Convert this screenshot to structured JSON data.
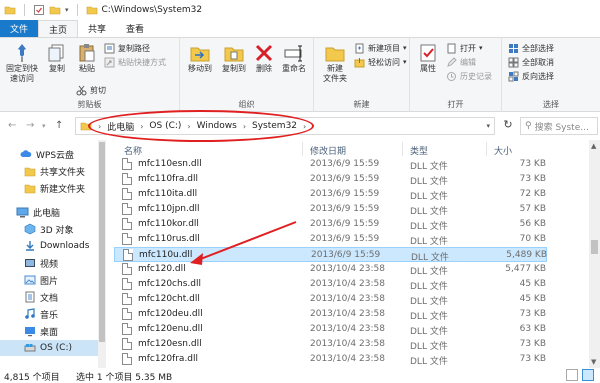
{
  "window": {
    "title": "C:\\Windows\\System32"
  },
  "tabs": {
    "file": "文件",
    "home": "主页",
    "share": "共享",
    "view": "查看"
  },
  "ribbon": {
    "clipboard": {
      "label": "剪贴板",
      "pin_quick_access": "固定到快\n速访问",
      "copy": "复制",
      "paste": "粘贴",
      "copy_path": "复制路径",
      "paste_shortcut": "粘贴快捷方式",
      "cut": "剪切"
    },
    "organize": {
      "label": "组织",
      "move_to": "移动到",
      "copy_to": "复制到",
      "delete": "删除",
      "rename": "重命名"
    },
    "new": {
      "label": "新建",
      "new_folder": "新建\n文件夹",
      "new_item": "新建项目",
      "easy_access": "轻松访问"
    },
    "open": {
      "label": "打开",
      "properties": "属性",
      "open": "打开",
      "edit": "编辑",
      "history": "历史记录"
    },
    "select": {
      "label": "选择",
      "select_all": "全部选择",
      "select_none": "全部取消",
      "invert": "反向选择"
    }
  },
  "address": {
    "crumbs": [
      "此电脑",
      "OS (C:)",
      "Windows",
      "System32"
    ],
    "search_placeholder": "搜索\"System...",
    "search_short": "搜索 Syste..."
  },
  "nav": {
    "items": [
      {
        "label": "WPS云盘",
        "icon": "cloud-icon"
      },
      {
        "label": "共享文件夹",
        "icon": "folder-icon"
      },
      {
        "label": "新建文件夹",
        "icon": "folder-icon"
      },
      {
        "label": "此电脑",
        "icon": "computer-icon"
      },
      {
        "label": "3D 对象",
        "icon": "cube-icon"
      },
      {
        "label": "Downloads",
        "icon": "download-icon"
      },
      {
        "label": "视频",
        "icon": "video-icon"
      },
      {
        "label": "图片",
        "icon": "picture-icon"
      },
      {
        "label": "文档",
        "icon": "document-icon"
      },
      {
        "label": "音乐",
        "icon": "music-icon"
      },
      {
        "label": "桌面",
        "icon": "desktop-icon"
      },
      {
        "label": "OS (C:)",
        "icon": "drive-icon"
      }
    ]
  },
  "columns": {
    "name": "名称",
    "date": "修改日期",
    "type": "类型",
    "size": "大小"
  },
  "files": [
    {
      "name": "mfc110esn.dll",
      "date": "2013/6/9 15:59",
      "type": "DLL 文件",
      "size": "73 KB"
    },
    {
      "name": "mfc110fra.dll",
      "date": "2013/6/9 15:59",
      "type": "DLL 文件",
      "size": "73 KB"
    },
    {
      "name": "mfc110ita.dll",
      "date": "2013/6/9 15:59",
      "type": "DLL 文件",
      "size": "72 KB"
    },
    {
      "name": "mfc110jpn.dll",
      "date": "2013/6/9 15:59",
      "type": "DLL 文件",
      "size": "57 KB"
    },
    {
      "name": "mfc110kor.dll",
      "date": "2013/6/9 15:59",
      "type": "DLL 文件",
      "size": "56 KB"
    },
    {
      "name": "mfc110rus.dll",
      "date": "2013/6/9 15:59",
      "type": "DLL 文件",
      "size": "70 KB"
    },
    {
      "name": "mfc110u.dll",
      "date": "2013/6/9 15:59",
      "type": "DLL 文件",
      "size": "5,489 KB"
    },
    {
      "name": "mfc120.dll",
      "date": "2013/10/4 23:58",
      "type": "DLL 文件",
      "size": "5,477 KB"
    },
    {
      "name": "mfc120chs.dll",
      "date": "2013/10/4 23:58",
      "type": "DLL 文件",
      "size": "45 KB"
    },
    {
      "name": "mfc120cht.dll",
      "date": "2013/10/4 23:58",
      "type": "DLL 文件",
      "size": "45 KB"
    },
    {
      "name": "mfc120deu.dll",
      "date": "2013/10/4 23:58",
      "type": "DLL 文件",
      "size": "73 KB"
    },
    {
      "name": "mfc120enu.dll",
      "date": "2013/10/4 23:58",
      "type": "DLL 文件",
      "size": "63 KB"
    },
    {
      "name": "mfc120esn.dll",
      "date": "2013/10/4 23:58",
      "type": "DLL 文件",
      "size": "73 KB"
    },
    {
      "name": "mfc120fra.dll",
      "date": "2013/10/4 23:58",
      "type": "DLL 文件",
      "size": "73 KB"
    }
  ],
  "status": {
    "count": "4,815 个项目",
    "selected": "选中 1 个项目  5.35 MB"
  },
  "colors": {
    "accent": "#1979ca",
    "annotation": "#e02020",
    "selection": "#cce8ff"
  }
}
